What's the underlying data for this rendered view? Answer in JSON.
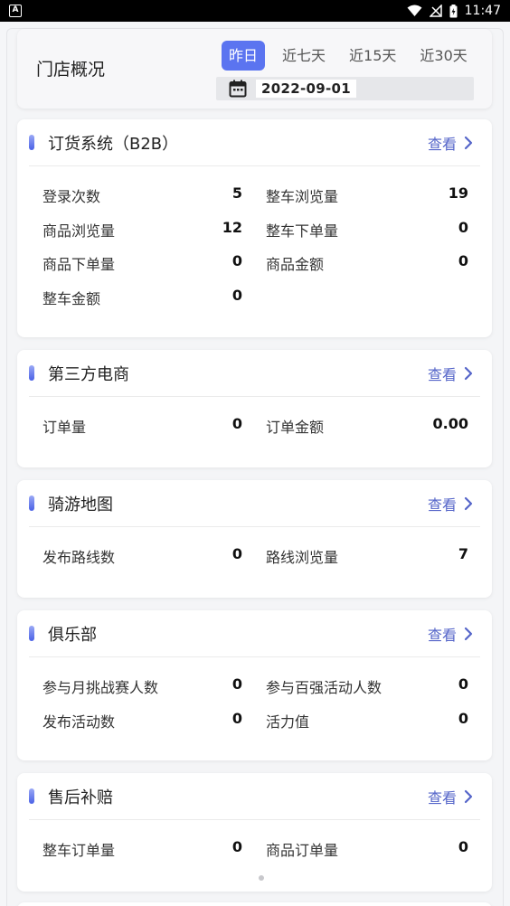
{
  "status_bar": {
    "app_icon_label": "A",
    "time": "11:47"
  },
  "header": {
    "title": "门店概况",
    "tabs": [
      {
        "label": "昨日",
        "active": true
      },
      {
        "label": "近七天",
        "active": false
      },
      {
        "label": "近15天",
        "active": false
      },
      {
        "label": "近30天",
        "active": false
      }
    ],
    "date": "2022-09-01"
  },
  "view_label": "查看",
  "sections": [
    {
      "title": "订货系统（B2B）",
      "rows": [
        [
          {
            "label": "登录次数",
            "value": "5"
          },
          {
            "label": "整车浏览量",
            "value": "19"
          }
        ],
        [
          {
            "label": "商品浏览量",
            "value": "12"
          },
          {
            "label": "整车下单量",
            "value": "0"
          }
        ],
        [
          {
            "label": "商品下单量",
            "value": "0"
          },
          {
            "label": "商品金额",
            "value": "0"
          }
        ],
        [
          {
            "label": "整车金额",
            "value": "0"
          }
        ]
      ]
    },
    {
      "title": "第三方电商",
      "rows": [
        [
          {
            "label": "订单量",
            "value": "0"
          },
          {
            "label": "订单金额",
            "value": "0.00"
          }
        ]
      ]
    },
    {
      "title": "骑游地图",
      "rows": [
        [
          {
            "label": "发布路线数",
            "value": "0"
          },
          {
            "label": "路线浏览量",
            "value": "7"
          }
        ]
      ]
    },
    {
      "title": "俱乐部",
      "rows": [
        [
          {
            "label": "参与月挑战赛人数",
            "value": "0"
          },
          {
            "label": "参与百强活动人数",
            "value": "0"
          }
        ],
        [
          {
            "label": "发布活动数",
            "value": "0"
          },
          {
            "label": "活力值",
            "value": "0"
          }
        ]
      ]
    },
    {
      "title": "售后补赔",
      "rows": [
        [
          {
            "label": "整车订单量",
            "value": "0"
          },
          {
            "label": "商品订单量",
            "value": "0"
          }
        ]
      ]
    }
  ],
  "colors": {
    "accent": "#5b74f0",
    "link": "#5565c9"
  }
}
